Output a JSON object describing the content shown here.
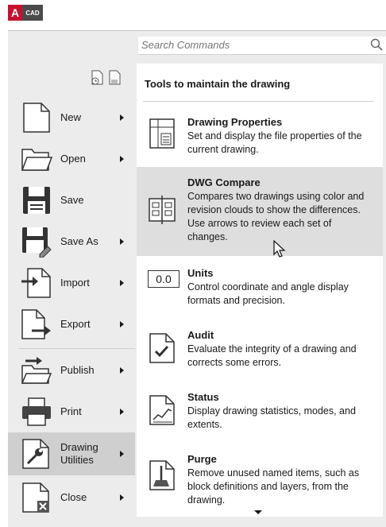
{
  "logo": {
    "letter": "A",
    "text": "CAD"
  },
  "search": {
    "placeholder": "Search Commands"
  },
  "menu": [
    {
      "label": "New",
      "has_arrow": true
    },
    {
      "label": "Open",
      "has_arrow": true
    },
    {
      "label": "Save",
      "has_arrow": false
    },
    {
      "label": "Save As",
      "has_arrow": true
    },
    {
      "label": "Import",
      "has_arrow": true
    },
    {
      "label": "Export",
      "has_arrow": true
    },
    {
      "label": "Publish",
      "has_arrow": true
    },
    {
      "label": "Print",
      "has_arrow": true
    },
    {
      "label": "Drawing Utilities",
      "has_arrow": true,
      "active": true
    },
    {
      "label": "Close",
      "has_arrow": true
    }
  ],
  "panel": {
    "title": "Tools to maintain the drawing",
    "tools": [
      {
        "name": "Drawing Properties",
        "desc": "Set and display the file properties of the current drawing.",
        "icon": "drawing-properties-icon"
      },
      {
        "name": "DWG Compare",
        "desc": "Compares two drawings using color and revision clouds to show the differences. Use arrows to review each set of changes.",
        "icon": "dwg-compare-icon",
        "highlighted": true
      },
      {
        "name": "Units",
        "desc": "Control coordinate and angle display formats and precision.",
        "icon": "units-icon",
        "icon_text": "0.0"
      },
      {
        "name": "Audit",
        "desc": "Evaluate the integrity of a drawing and corrects some errors.",
        "icon": "audit-icon"
      },
      {
        "name": "Status",
        "desc": "Display drawing statistics, modes, and extents.",
        "icon": "status-icon"
      },
      {
        "name": "Purge",
        "desc": "Remove unused named items, such as block definitions and layers, from the drawing.",
        "icon": "purge-icon"
      }
    ]
  }
}
